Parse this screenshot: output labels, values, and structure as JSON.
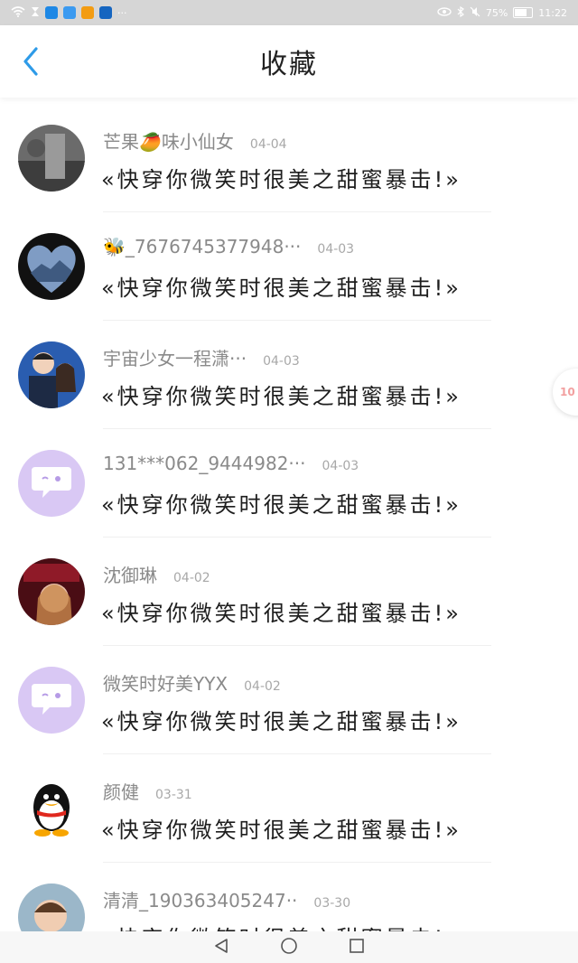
{
  "status_bar": {
    "battery": "75%",
    "time": "11:22",
    "more": "···",
    "app_icons": [
      {
        "name": "search-app-icon",
        "color": "#1e88e5"
      },
      {
        "name": "wechat-app-icon",
        "color": "#3b9af0"
      },
      {
        "name": "orange-app-icon",
        "color": "#f39c12"
      },
      {
        "name": "blue-app-icon",
        "color": "#1565c0"
      }
    ]
  },
  "header": {
    "title": "收藏",
    "back_icon": "chevron-left-icon",
    "accent": "#2e9be8"
  },
  "items": [
    {
      "name": "芒果🥭味小仙女",
      "date": "04-04",
      "message": "«快穿你微笑时很美之甜蜜暴击!»",
      "avatar": "photo-dark"
    },
    {
      "name": "🐝_7676745377948···",
      "date": "04-03",
      "message": "«快穿你微笑时很美之甜蜜暴击!»",
      "avatar": "heart-mountains"
    },
    {
      "name": "宇宙少女一程潇···",
      "date": "04-03",
      "message": "«快穿你微笑时很美之甜蜜暴击!»",
      "avatar": "couple-photo"
    },
    {
      "name": "131***062_9444982···",
      "date": "04-03",
      "message": "«快穿你微笑时很美之甜蜜暴击!»",
      "avatar": "default-purple"
    },
    {
      "name": "沈御琳",
      "date": "04-02",
      "message": "«快穿你微笑时很美之甜蜜暴击!»",
      "avatar": "red-portrait"
    },
    {
      "name": "微笑时好美YYX",
      "date": "04-02",
      "message": "«快穿你微笑时很美之甜蜜暴击!»",
      "avatar": "default-purple"
    },
    {
      "name": "颜健",
      "date": "03-31",
      "message": "«快穿你微笑时很美之甜蜜暴击!»",
      "avatar": "qq-penguin"
    },
    {
      "name": "清清_190363405247··",
      "date": "03-30",
      "message": "«快穿你微笑时很美之甜蜜暴击!»",
      "avatar": "baby-photo"
    }
  ],
  "float_badge": "10",
  "nav": {
    "back": "back-triangle-icon",
    "home": "home-circle-icon",
    "recent": "recent-square-icon"
  }
}
